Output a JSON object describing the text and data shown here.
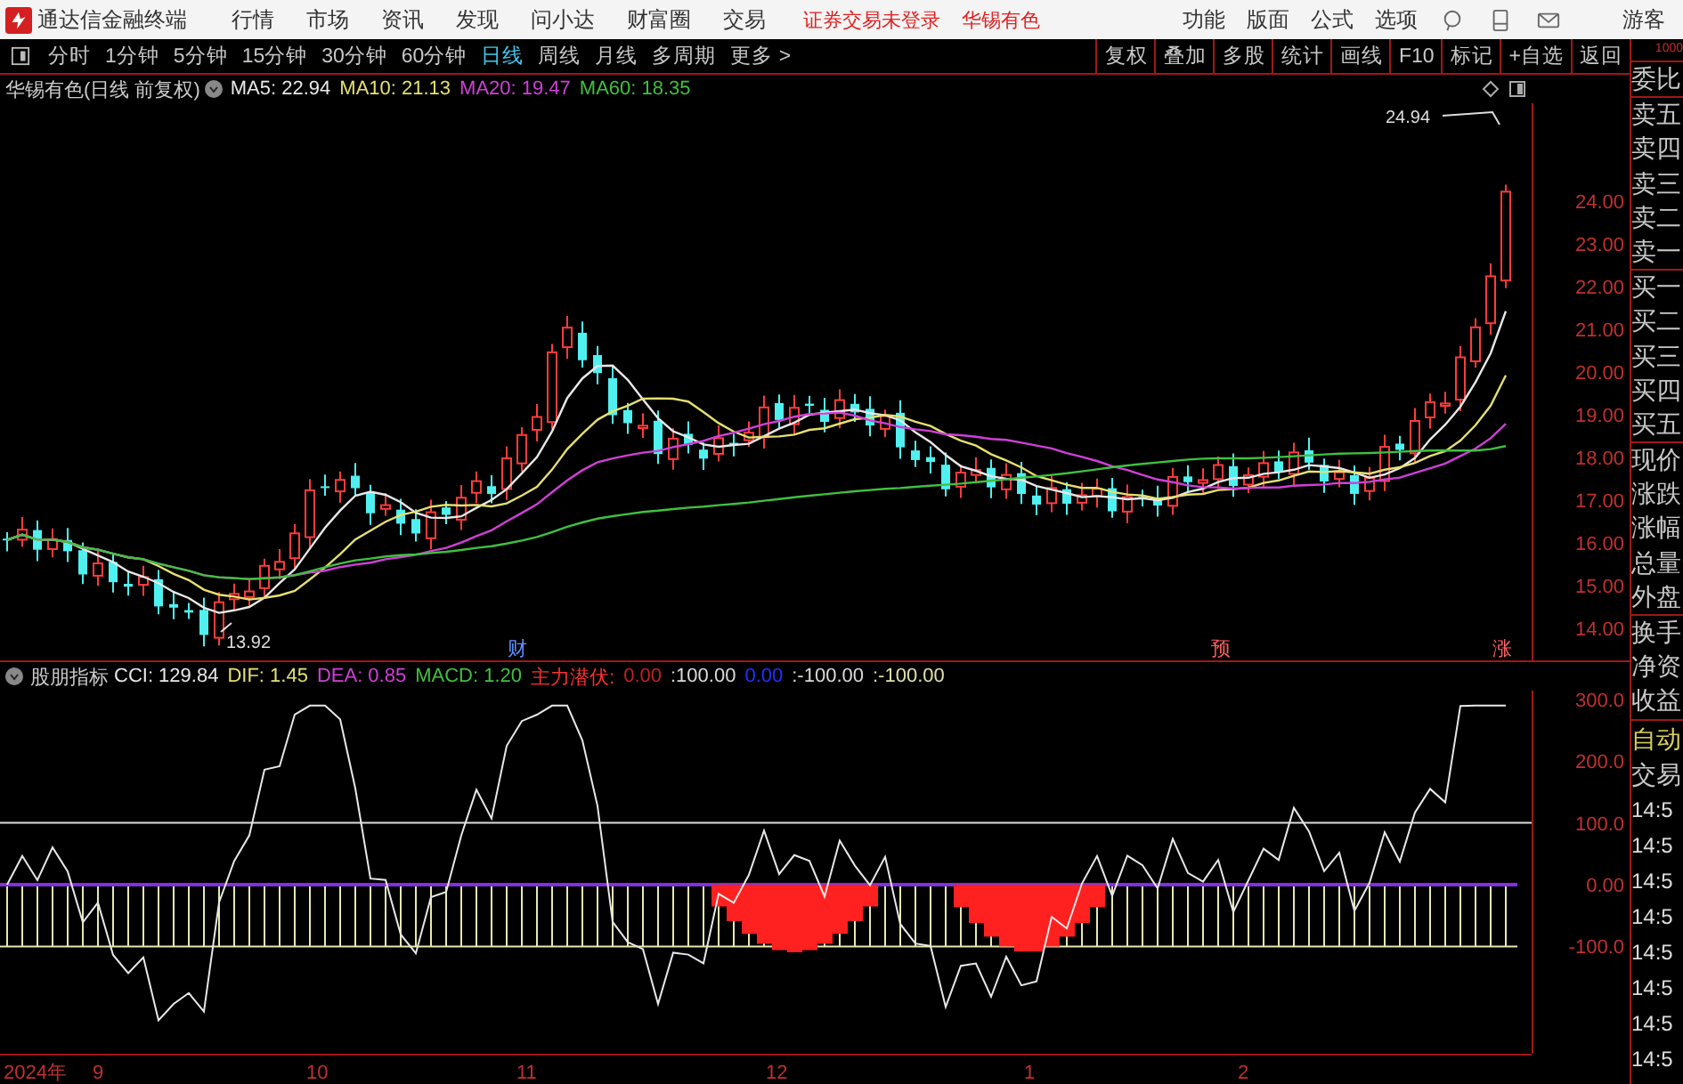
{
  "app_bar": {
    "title": "通达信金融终端",
    "menu": [
      "行情",
      "市场",
      "资讯",
      "发现",
      "问小达",
      "财富圈",
      "交易"
    ],
    "notice": [
      "证券交易未登录",
      "华锡有色"
    ],
    "tools": [
      "功能",
      "版面",
      "公式",
      "选项"
    ],
    "user": "游客"
  },
  "period_bar": {
    "periods": [
      {
        "label": "分时",
        "selected": false
      },
      {
        "label": "1分钟",
        "selected": false
      },
      {
        "label": "5分钟",
        "selected": false
      },
      {
        "label": "15分钟",
        "selected": false
      },
      {
        "label": "30分钟",
        "selected": false
      },
      {
        "label": "60分钟",
        "selected": false
      },
      {
        "label": "日线",
        "selected": true
      },
      {
        "label": "周线",
        "selected": false
      },
      {
        "label": "月线",
        "selected": false
      },
      {
        "label": "多周期",
        "selected": false
      }
    ],
    "more": "更多 >",
    "actions": [
      "复权",
      "叠加",
      "多股",
      "统计",
      "画线",
      "F10",
      "标记",
      "+自选",
      "返回"
    ]
  },
  "price_chart": {
    "title": "华锡有色(日线 前复权)",
    "ma": [
      {
        "label": "MA5: 22.94",
        "color": "#e8e8e8"
      },
      {
        "label": "MA10: 21.13",
        "color": "#e6e070"
      },
      {
        "label": "MA20: 19.47",
        "color": "#d040d8"
      },
      {
        "label": "MA60: 18.35",
        "color": "#40c040"
      }
    ],
    "y_labels": [
      "24.00",
      "23.00",
      "22.00",
      "21.00",
      "20.00",
      "19.00",
      "18.00",
      "17.00",
      "16.00",
      "15.00",
      "14.00"
    ],
    "high_label": "24.94",
    "low_label": "13.92",
    "event_marks": [
      "财",
      "预",
      "涨"
    ]
  },
  "indicator": {
    "title": "股朋指标",
    "values": [
      {
        "label": "CCI: 129.84",
        "color": "#e8e8e8"
      },
      {
        "label": "DIF: 1.45",
        "color": "#e6e070"
      },
      {
        "label": "DEA: 0.85",
        "color": "#d040d8"
      },
      {
        "label": "MACD: 1.20",
        "color": "#40c040"
      },
      {
        "label": "主力潜伏:",
        "color": "#ff3030"
      },
      {
        "label": "0.00",
        "color": "#c02020"
      },
      {
        "label": ":100.00",
        "color": "#d8d8d8"
      },
      {
        "label": "0.00",
        "color": "#2030ff"
      },
      {
        "label": ":-100.00",
        "color": "#d8d8d8"
      },
      {
        "label": ":-100.00",
        "color": "#e0e0a8"
      }
    ],
    "y_labels": [
      "300.0",
      "200.0",
      "100.0",
      "0.00",
      "-100.0"
    ]
  },
  "time_axis": {
    "labels": [
      "2024年",
      "9",
      "10",
      "11",
      "12",
      "1",
      "2"
    ]
  },
  "quote_panel": {
    "scale": "1000",
    "groups": [
      [
        "委比"
      ],
      [
        "卖五",
        "卖四",
        "卖三",
        "卖二",
        "卖一"
      ],
      [
        "买一",
        "买二",
        "买三",
        "买四",
        "买五"
      ],
      [
        "现价",
        "涨跌",
        "涨幅",
        "总量",
        "外盘"
      ],
      [
        "换手",
        "净资",
        "收益"
      ]
    ],
    "trade_header": [
      "自动",
      "交易"
    ],
    "times": [
      "14:5",
      "14:5",
      "14:5",
      "14:5",
      "14:5",
      "14:5",
      "14:5",
      "14:5"
    ]
  }
}
